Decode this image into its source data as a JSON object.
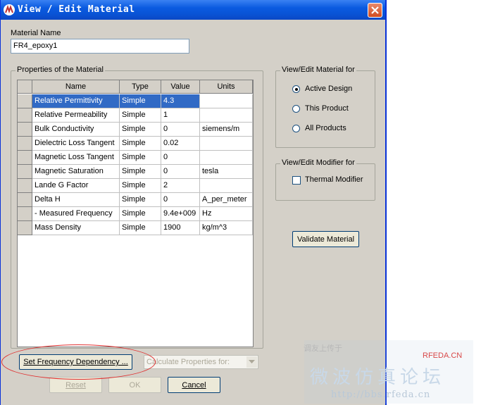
{
  "window": {
    "title": "View / Edit Material",
    "close_glyph": "×"
  },
  "material_name": {
    "label": "Material Name",
    "value": "FR4_epoxy1"
  },
  "properties": {
    "group_title": "Properties of the Material",
    "columns": [
      "Name",
      "Type",
      "Value",
      "Units"
    ],
    "rows": [
      {
        "name": "Relative Permittivity",
        "type": "Simple",
        "value": "4.3",
        "units": "",
        "selected": true
      },
      {
        "name": "Relative Permeability",
        "type": "Simple",
        "value": "1",
        "units": ""
      },
      {
        "name": "Bulk Conductivity",
        "type": "Simple",
        "value": "0",
        "units": "siemens/m"
      },
      {
        "name": "Dielectric Loss Tangent",
        "type": "Simple",
        "value": "0.02",
        "units": ""
      },
      {
        "name": "Magnetic Loss Tangent",
        "type": "Simple",
        "value": "0",
        "units": ""
      },
      {
        "name": "Magnetic Saturation",
        "type": "Simple",
        "value": "0",
        "units": "tesla"
      },
      {
        "name": "Lande G Factor",
        "type": "Simple",
        "value": "2",
        "units": ""
      },
      {
        "name": "Delta H",
        "type": "Simple",
        "value": "0",
        "units": "A_per_meter"
      },
      {
        "name": "- Measured Frequency",
        "type": "Simple",
        "value": "9.4e+009",
        "units": "Hz"
      },
      {
        "name": "Mass Density",
        "type": "Simple",
        "value": "1900",
        "units": "kg/m^3"
      }
    ]
  },
  "edit_for": {
    "group_title": "View/Edit Material for",
    "options": [
      "Active Design",
      "This Product",
      "All Products"
    ],
    "selected_index": 0
  },
  "modifier": {
    "group_title": "View/Edit Modifier for",
    "checkbox_label": "Thermal Modifier",
    "checked": false
  },
  "buttons": {
    "validate": "Validate Material",
    "set_freq": "Set Frequency Dependency ...",
    "reset": "Reset",
    "ok": "OK",
    "cancel": "Cancel"
  },
  "calc_combo": {
    "value": "Calculate Properties for:"
  },
  "watermark": {
    "small_cn": "调友上传于",
    "logo": "RFEDA.CN",
    "big_cn": "微波仿真论坛",
    "url": "http://bbs.rfeda.cn"
  },
  "colors": {
    "title_bar": "#0a5ae0",
    "selection": "#316ac5",
    "dialog_bg": "#d4d0c8",
    "highlight_oval": "#e03030"
  }
}
